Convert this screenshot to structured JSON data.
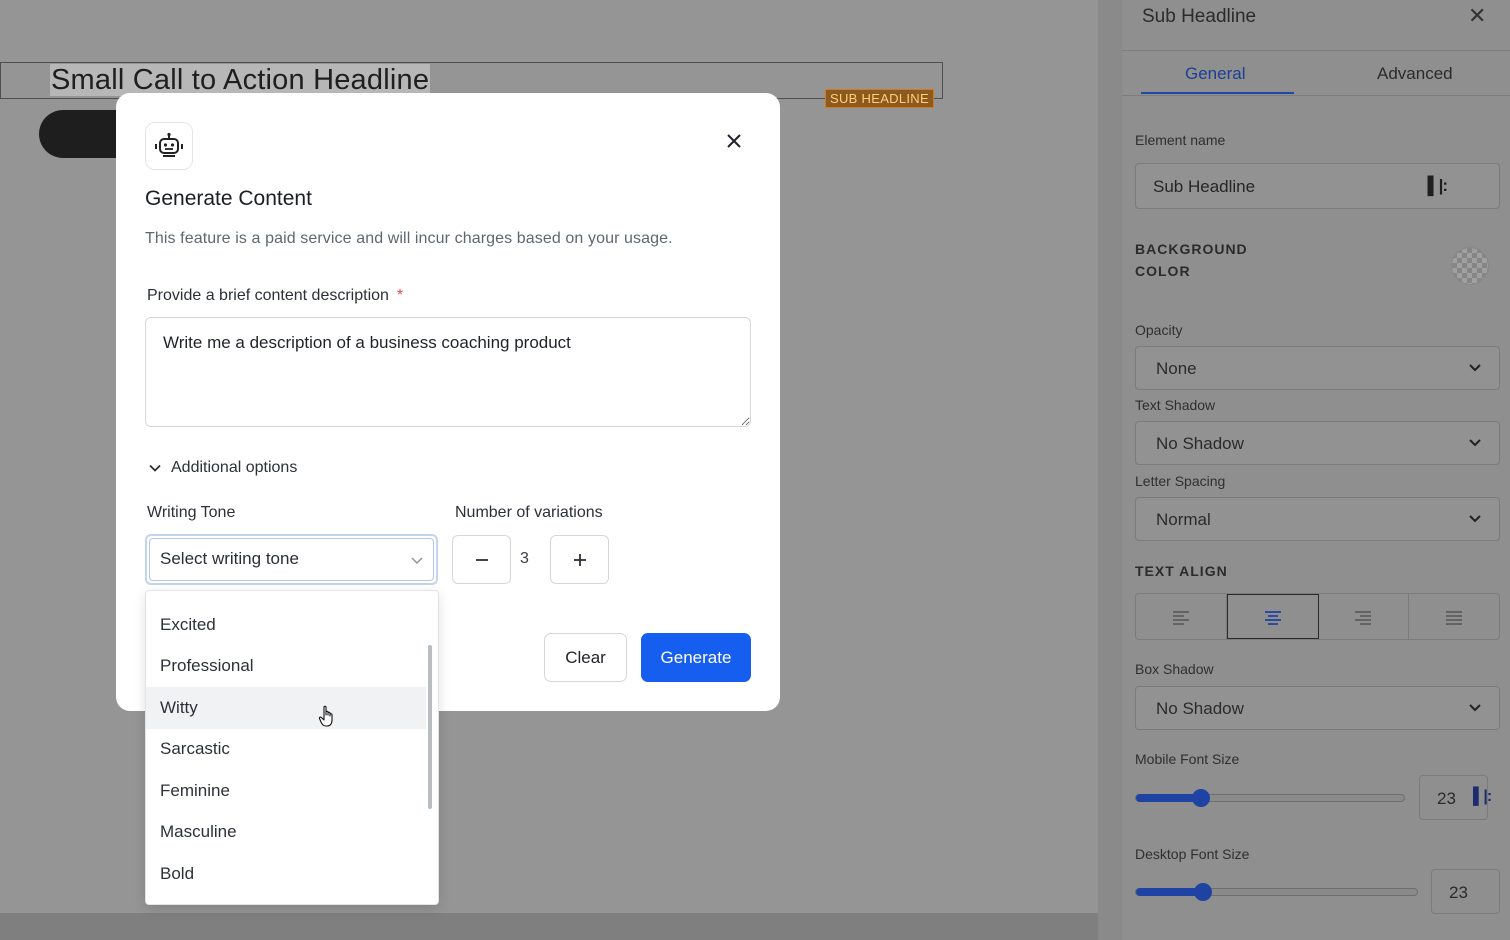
{
  "canvas": {
    "headline": "Small Call to Action Headline",
    "badge": "SUB HEADLINE"
  },
  "panel": {
    "title": "Sub Headline",
    "close_icon": "close-icon",
    "tabs": [
      {
        "label": "General",
        "active": true
      },
      {
        "label": "Advanced",
        "active": false
      }
    ],
    "element_name_label": "Element name",
    "element_name_value": "Sub Headline",
    "background_color_label": "BACKGROUND\nCOLOR",
    "opacity_label": "Opacity",
    "opacity_value": "None",
    "text_shadow_label": "Text Shadow",
    "text_shadow_value": "No Shadow",
    "letter_spacing_label": "Letter Spacing",
    "letter_spacing_value": "Normal",
    "text_align_label": "TEXT ALIGN",
    "text_align_options": [
      "left",
      "center",
      "right",
      "justify"
    ],
    "text_align_active": "center",
    "box_shadow_label": "Box Shadow",
    "box_shadow_value": "No Shadow",
    "mobile_font_label": "Mobile Font Size",
    "mobile_font_value": "23",
    "desktop_font_label": "Desktop Font Size",
    "desktop_font_value": "23",
    "accent_color": "#1f43a3"
  },
  "modal": {
    "logo_icon": "robot-icon",
    "title": "Generate Content",
    "subtitle": "This feature is a paid service and will incur charges based on your usage.",
    "desc_label": "Provide a brief content description",
    "required_mark": "*",
    "desc_value": "Write me a description of a business coaching product",
    "additional_options": "Additional options",
    "tone_label": "Writing Tone",
    "tone_placeholder": "Select writing tone",
    "variations_label": "Number of variations",
    "variations_value": "3",
    "clear_label": "Clear",
    "generate_label": "Generate",
    "primary_color": "#155eef"
  },
  "tone_options": [
    "Excited",
    "Professional",
    "Witty",
    "Sarcastic",
    "Feminine",
    "Masculine",
    "Bold"
  ],
  "tone_hovered": "Witty"
}
